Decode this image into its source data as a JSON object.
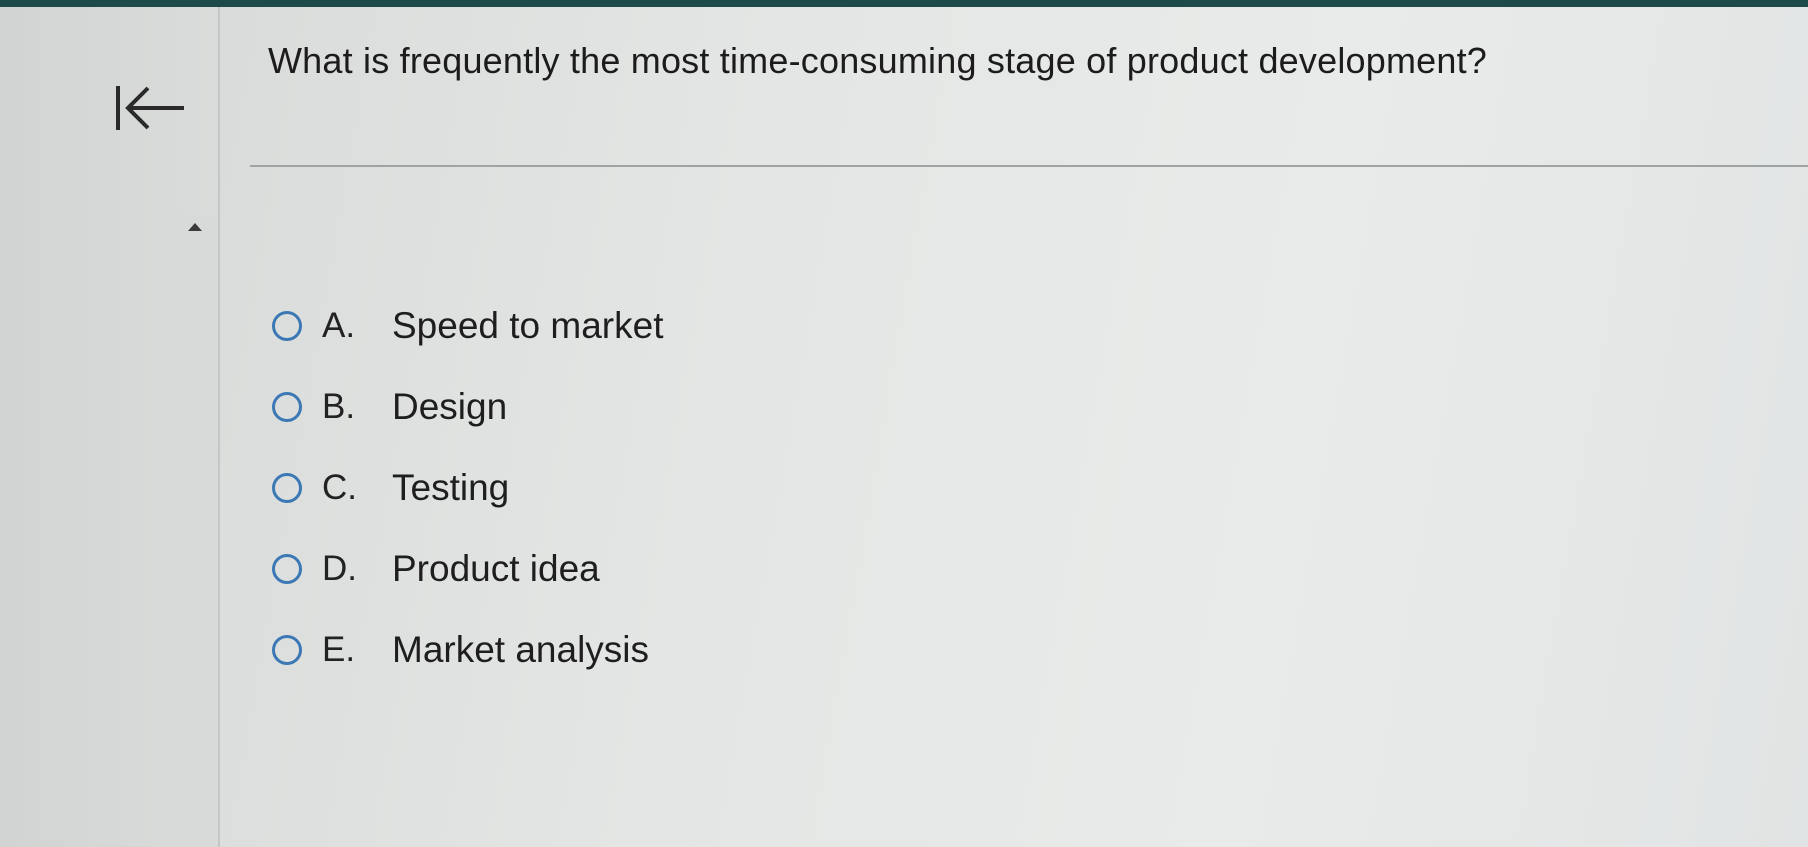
{
  "question": {
    "text": "What is frequently the most time-consuming stage of product development?"
  },
  "navigation": {
    "back_icon": "collapse-left-arrow-icon",
    "scroll_icon": "scroll-up-arrow-icon"
  },
  "choices": [
    {
      "letter": "A.",
      "text": "Speed to market"
    },
    {
      "letter": "B.",
      "text": "Design"
    },
    {
      "letter": "C.",
      "text": "Testing"
    },
    {
      "letter": "D.",
      "text": "Product idea"
    },
    {
      "letter": "E.",
      "text": "Market analysis"
    }
  ],
  "colors": {
    "radio_border": "#3b78b4",
    "top_bar": "#1f4a4a"
  }
}
